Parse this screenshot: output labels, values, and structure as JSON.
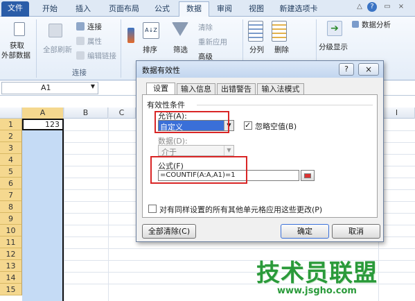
{
  "tabs": [
    "文件",
    "开始",
    "插入",
    "页面布局",
    "公式",
    "数据",
    "审阅",
    "视图",
    "新建选项卡"
  ],
  "window_controls": [
    "△",
    "?",
    "▭",
    "×"
  ],
  "ribbon": {
    "get_external": [
      "获取",
      "外部数据"
    ],
    "refresh_all": "全部刷新",
    "connections": "连接",
    "properties": "属性",
    "edit_links": "编辑链接",
    "group_connections": "连接",
    "sort_az_icon": "A↓Z",
    "sort": "排序",
    "filter": "筛选",
    "clear": "清除",
    "reapply": "重新应用",
    "advanced": "高级",
    "split": "分列",
    "delete_dup": "删除",
    "outline": "分级显示",
    "data_analysis": "数据分析"
  },
  "formula_bar": {
    "name_box": "A1"
  },
  "grid": {
    "columns": [
      "A",
      "B",
      "C",
      "I"
    ],
    "rows": [
      "1",
      "2",
      "3",
      "4",
      "5",
      "6",
      "7",
      "8",
      "9",
      "10",
      "11",
      "12",
      "13",
      "14",
      "15"
    ],
    "a1_value": "123"
  },
  "dialog": {
    "title": "数据有效性",
    "tabs": [
      "设置",
      "输入信息",
      "出错警告",
      "输入法模式"
    ],
    "section": "有效性条件",
    "allow_label": "允许(A):",
    "allow_value": "自定义",
    "ignore_blank": "忽略空值(B)",
    "data_label": "数据(D):",
    "data_value": "介于",
    "formula_label": "公式(F)",
    "formula_value": "=COUNTIF(A:A,A1)=1",
    "apply_all": "对有同样设置的所有其他单元格应用这些更改(P)",
    "clear_all": "全部清除(C)",
    "ok": "确定",
    "cancel": "取消"
  },
  "watermark": {
    "title": "技术员联盟",
    "url": "www.jsgho.com"
  }
}
